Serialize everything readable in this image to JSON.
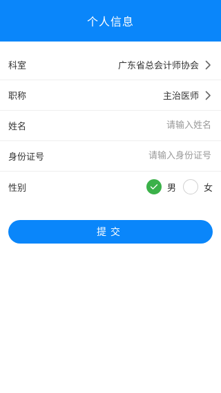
{
  "header": {
    "title": "个人信息"
  },
  "form": {
    "department": {
      "label": "科室",
      "value": "广东省总会计师协会"
    },
    "title": {
      "label": "职称",
      "value": "主治医师"
    },
    "name": {
      "label": "姓名",
      "value": "",
      "placeholder": "请输入姓名"
    },
    "id_number": {
      "label": "身份证号",
      "value": "",
      "placeholder": "请输入身份证号"
    },
    "gender": {
      "label": "性别",
      "options": [
        "男",
        "女"
      ],
      "selected": "男"
    }
  },
  "submit_label": "提交",
  "colors": {
    "primary": "#0a86fa",
    "checked": "#3bb149",
    "divider": "#eeeeee"
  },
  "icons": {
    "chevron": "chevron-right-icon",
    "check": "check-icon"
  }
}
